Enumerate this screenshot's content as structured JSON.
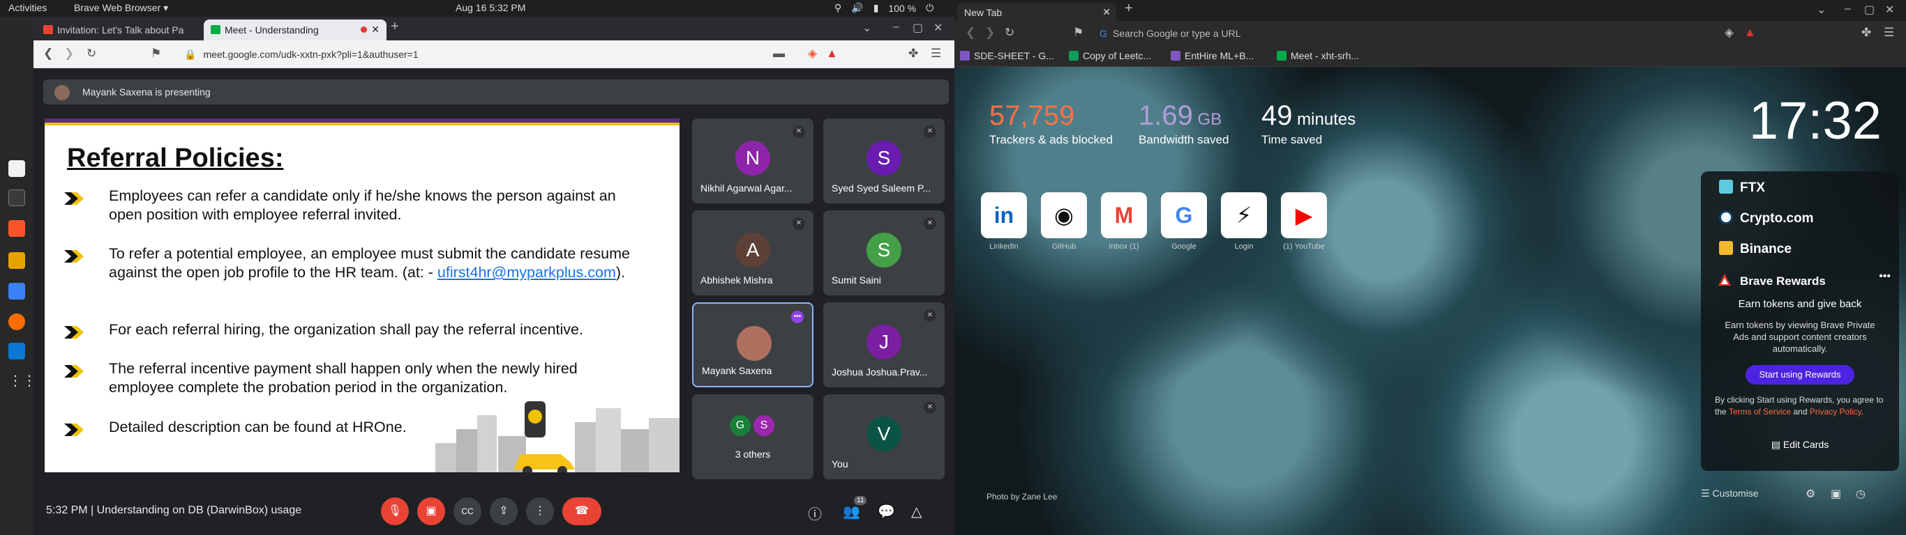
{
  "topbar": {
    "activities": "Activities",
    "app": "Brave Web Browser ▾",
    "clock": "Aug 16  5:32 PM",
    "battery": "100 %"
  },
  "left": {
    "tabs": [
      {
        "title": "Invitation: Let's Talk about Pa",
        "color": "#ea4335"
      },
      {
        "title": "Meet - Understanding",
        "color": "#00ac47"
      }
    ],
    "url": "meet.google.com/udk-xxtn-pxk?pli=1&authuser=1",
    "presenting": "Mayank Saxena is presenting",
    "slide": {
      "title": "Referral Policies:",
      "points": [
        {
          "text": "Employees can refer a candidate only if he/she knows the person against an open position with employee referral invited."
        },
        {
          "text": "To refer a potential employee, an employee must submit the candidate resume against the open job profile to the HR team. (at: -",
          "link": "ufirst4hr@myparkplus.com",
          "tail": ")."
        },
        {
          "text": "For each referral hiring, the organization shall pay the referral incentive."
        },
        {
          "text": "The referral incentive payment shall happen only when the newly hired employee complete the probation period in the organization."
        },
        {
          "text": "Detailed description can be found at HROne."
        }
      ]
    },
    "tiles": [
      {
        "initial": "N",
        "name": "Nikhil Agarwal Agar...",
        "color": "#8e24aa"
      },
      {
        "initial": "S",
        "name": "Syed Syed Saleem P...",
        "color": "#6a1bb0"
      },
      {
        "initial": "A",
        "name": "Abhishek Mishra",
        "color": "#5d4037"
      },
      {
        "initial": "S",
        "name": "Sumit Saini",
        "color": "#43a047"
      },
      {
        "initial": "",
        "name": "Mayank Saxena",
        "color": "#b07060"
      },
      {
        "initial": "J",
        "name": "Joshua Joshua.Prav...",
        "color": "#7b1fa2"
      },
      {
        "initial": "",
        "name": "3 others",
        "color": "#3c4043"
      },
      {
        "initial": "V",
        "name": "You",
        "color": "#0b5345"
      }
    ],
    "others": {
      "g": "G",
      "s": "S"
    },
    "meeting_info": "5:32 PM  |  Understanding on DB (DarwinBox) usage",
    "participants_count": "11"
  },
  "right": {
    "tab": "New Tab",
    "url_placeholder": "Search Google or type a URL",
    "bookmarks": [
      "SDE-SHEET - G...",
      "Copy of Leetc...",
      "EntHire ML+B...",
      "Meet - xht-srh..."
    ],
    "stats": [
      {
        "num": "57,759",
        "unit": "",
        "label": "Trackers & ads blocked",
        "color": "#ff7043"
      },
      {
        "num": "1.69",
        "unit": " GB",
        "label": "Bandwidth saved",
        "color": "#b39ddb"
      },
      {
        "num": "49",
        "unit": " minutes",
        "label": "Time saved",
        "color": "#ffffff"
      }
    ],
    "clock": "17:32",
    "sites": [
      {
        "label": "LinkedIn",
        "glyph": "in",
        "color": "#0a66c2"
      },
      {
        "label": "GitHub",
        "glyph": "◉",
        "color": "#111"
      },
      {
        "label": "Inbox (1)",
        "glyph": "M",
        "color": "#ea4335"
      },
      {
        "label": "Google",
        "glyph": "G",
        "color": "#4285f4"
      },
      {
        "label": "Login",
        "glyph": "⚡",
        "color": "#111"
      },
      {
        "label": "(1) YouTube",
        "glyph": "▶",
        "color": "#ff0000"
      }
    ],
    "photo": "Photo by Zane Lee",
    "crypto": [
      "FTX",
      "Crypto.com",
      "Binance"
    ],
    "rewards": {
      "title": "Brave Rewards",
      "sub": "Earn tokens and give back",
      "desc": "Earn tokens by viewing Brave Private Ads and support content creators automatically.",
      "button": "Start using Rewards",
      "tos1": "By clicking Start using Rewards, you agree to the ",
      "tos_link1": "Terms of Service",
      "tos_and": " and ",
      "tos_link2": "Privacy Policy",
      "tos_end": "."
    },
    "edit": "Edit Cards",
    "customise": "Customise"
  }
}
